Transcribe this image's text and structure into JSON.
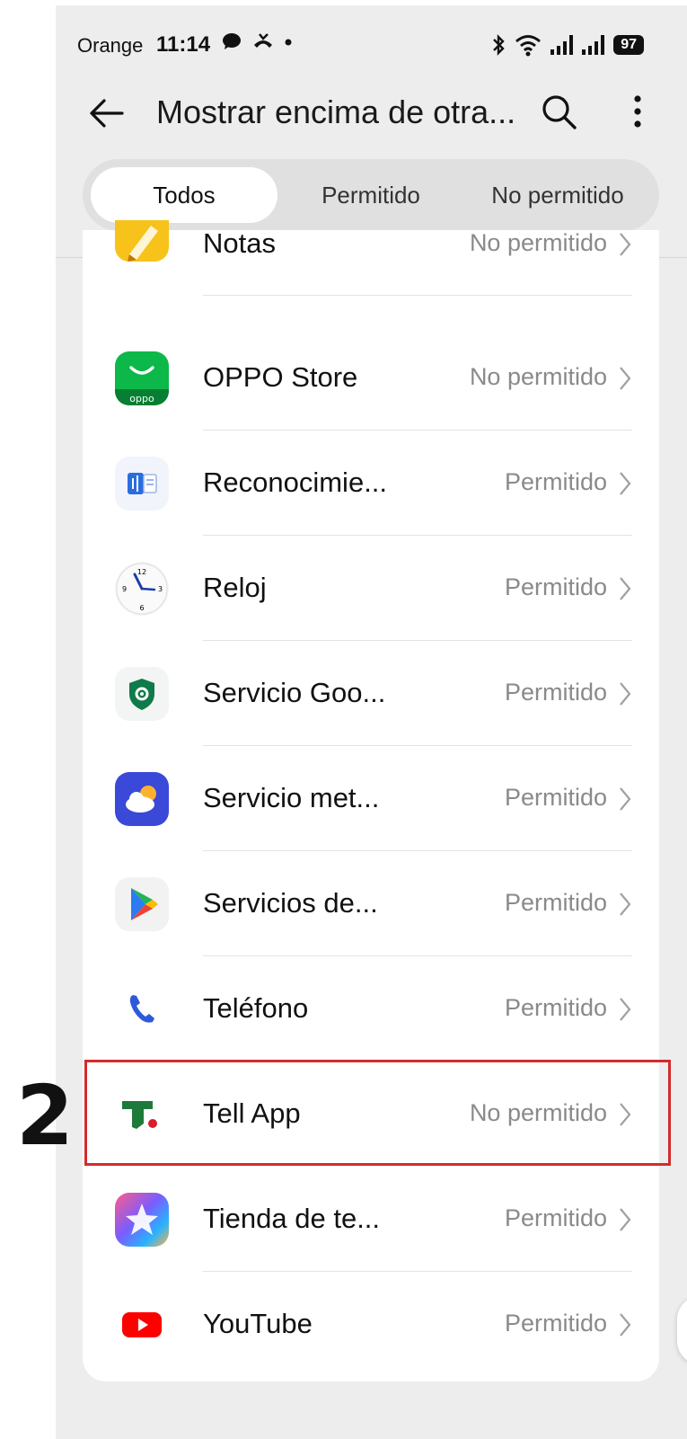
{
  "status_bar": {
    "carrier": "Orange",
    "time": "11:14",
    "battery": "97"
  },
  "header": {
    "title": "Mostrar encima de otra..."
  },
  "tabs": [
    {
      "label": "Todos",
      "active": true
    },
    {
      "label": "Permitido",
      "active": false
    },
    {
      "label": "No permitido",
      "active": false
    }
  ],
  "apps": [
    {
      "name": "Notas",
      "status": "No permitido",
      "icon": "notes-icon"
    },
    {
      "name": "OPPO Store",
      "status": "No permitido",
      "icon": "oppo-store-icon"
    },
    {
      "name": "Reconocimie...",
      "status": "Permitido",
      "icon": "voice-recognition-icon"
    },
    {
      "name": "Reloj",
      "status": "Permitido",
      "icon": "clock-icon"
    },
    {
      "name": "Servicio Goo...",
      "status": "Permitido",
      "icon": "google-services-icon"
    },
    {
      "name": "Servicio met...",
      "status": "Permitido",
      "icon": "weather-icon"
    },
    {
      "name": "Servicios de...",
      "status": "Permitido",
      "icon": "google-play-icon"
    },
    {
      "name": "Teléfono",
      "status": "Permitido",
      "icon": "phone-icon"
    },
    {
      "name": "Tell App",
      "status": "No permitido",
      "icon": "tell-app-icon"
    },
    {
      "name": "Tienda de te...",
      "status": "Permitido",
      "icon": "theme-store-icon"
    },
    {
      "name": "YouTube",
      "status": "Permitido",
      "icon": "youtube-icon"
    }
  ],
  "annotation": {
    "step_number": "2",
    "color": "#d32b2b"
  }
}
